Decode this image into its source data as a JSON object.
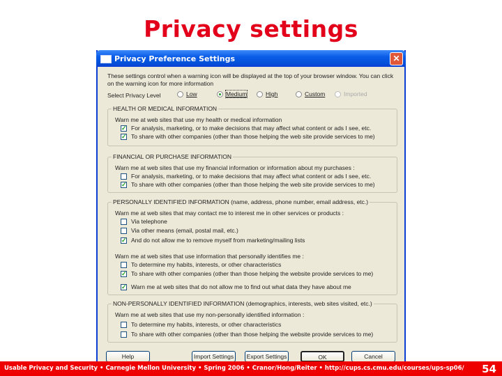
{
  "slide": {
    "title": "Privacy settings",
    "footer_text": "Usable Privacy and Security • Carnegie Mellon University • Spring 2006 • Cranor/Hong/Reiter • http://cups.cs.cmu.edu/courses/ups-sp06/",
    "page_number": "54",
    "accent_color": "#e3001b"
  },
  "dialog": {
    "title": "Privacy Preference Settings",
    "close_icon": "close-icon",
    "intro": "These settings control when a warning icon will be displayed at the top of your browser window. You can click on the warning icon for more information",
    "level_label": "Select Privacy Level",
    "levels": [
      {
        "label": "Low",
        "selected": false,
        "enabled": true
      },
      {
        "label": "Medium",
        "selected": true,
        "enabled": true
      },
      {
        "label": "High",
        "selected": false,
        "enabled": true
      },
      {
        "label": "Custom",
        "selected": false,
        "enabled": true
      },
      {
        "label": "Imported",
        "selected": false,
        "enabled": false
      }
    ],
    "groups": [
      {
        "legend": "HEALTH OR MEDICAL INFORMATION",
        "desc": "Warn me at web sites that use my health or medical information",
        "items": [
          {
            "label": "For analysis, marketing, or to make decisions that may affect what content or ads I see, etc.",
            "checked": true
          },
          {
            "label": "To share with other companies (other than those helping the web site provide services to me)",
            "checked": true
          }
        ]
      },
      {
        "legend": "FINANCIAL OR PURCHASE INFORMATION",
        "desc": "Warn me at web sites that use my financial information or information about my purchases :",
        "items": [
          {
            "label": "For analysis, marketing, or to make decisions that may affect what content or ads I see, etc.",
            "checked": false
          },
          {
            "label": "To share with other companies (other than those helping the web site provide services to me)",
            "checked": true
          }
        ]
      },
      {
        "legend": "PERSONALLY IDENTIFIED INFORMATION (name, address, phone number, email address, etc.)",
        "desc": "Warn me at web sites that may contact me to interest me in other services or products :",
        "items": [
          {
            "label": "Via telephone",
            "checked": false
          },
          {
            "label": "Via other means (email, postal mail, etc.)",
            "checked": false
          },
          {
            "label": "And do not allow me to remove myself from marketing/mailing lists",
            "checked": true
          }
        ],
        "desc2": "Warn me at web sites that use information that personally identifies me :",
        "items2": [
          {
            "label": "To determine my habits, interests, or other characteristics",
            "checked": false
          },
          {
            "label": "To share with other companies (other than those helping the website provide services to me)",
            "checked": true
          },
          {
            "label": "Warn me at web sites that do not allow me to find out what data they have about me",
            "checked": true
          }
        ]
      },
      {
        "legend": "NON-PERSONALLY IDENTIFIED INFORMATION (demographics, interests, web sites visited, etc.)",
        "desc": "Warn me at web sites that use my non-personally identified information :",
        "items": [
          {
            "label": "To determine my habits, interests, or other characteristics",
            "checked": false
          },
          {
            "label": "To share with other companies (other than those helping the website provide services to me)",
            "checked": false
          }
        ]
      }
    ],
    "buttons": {
      "help": "Help",
      "import": "Import Settings",
      "export": "Export Settings",
      "ok": "OK",
      "cancel": "Cancel"
    }
  }
}
